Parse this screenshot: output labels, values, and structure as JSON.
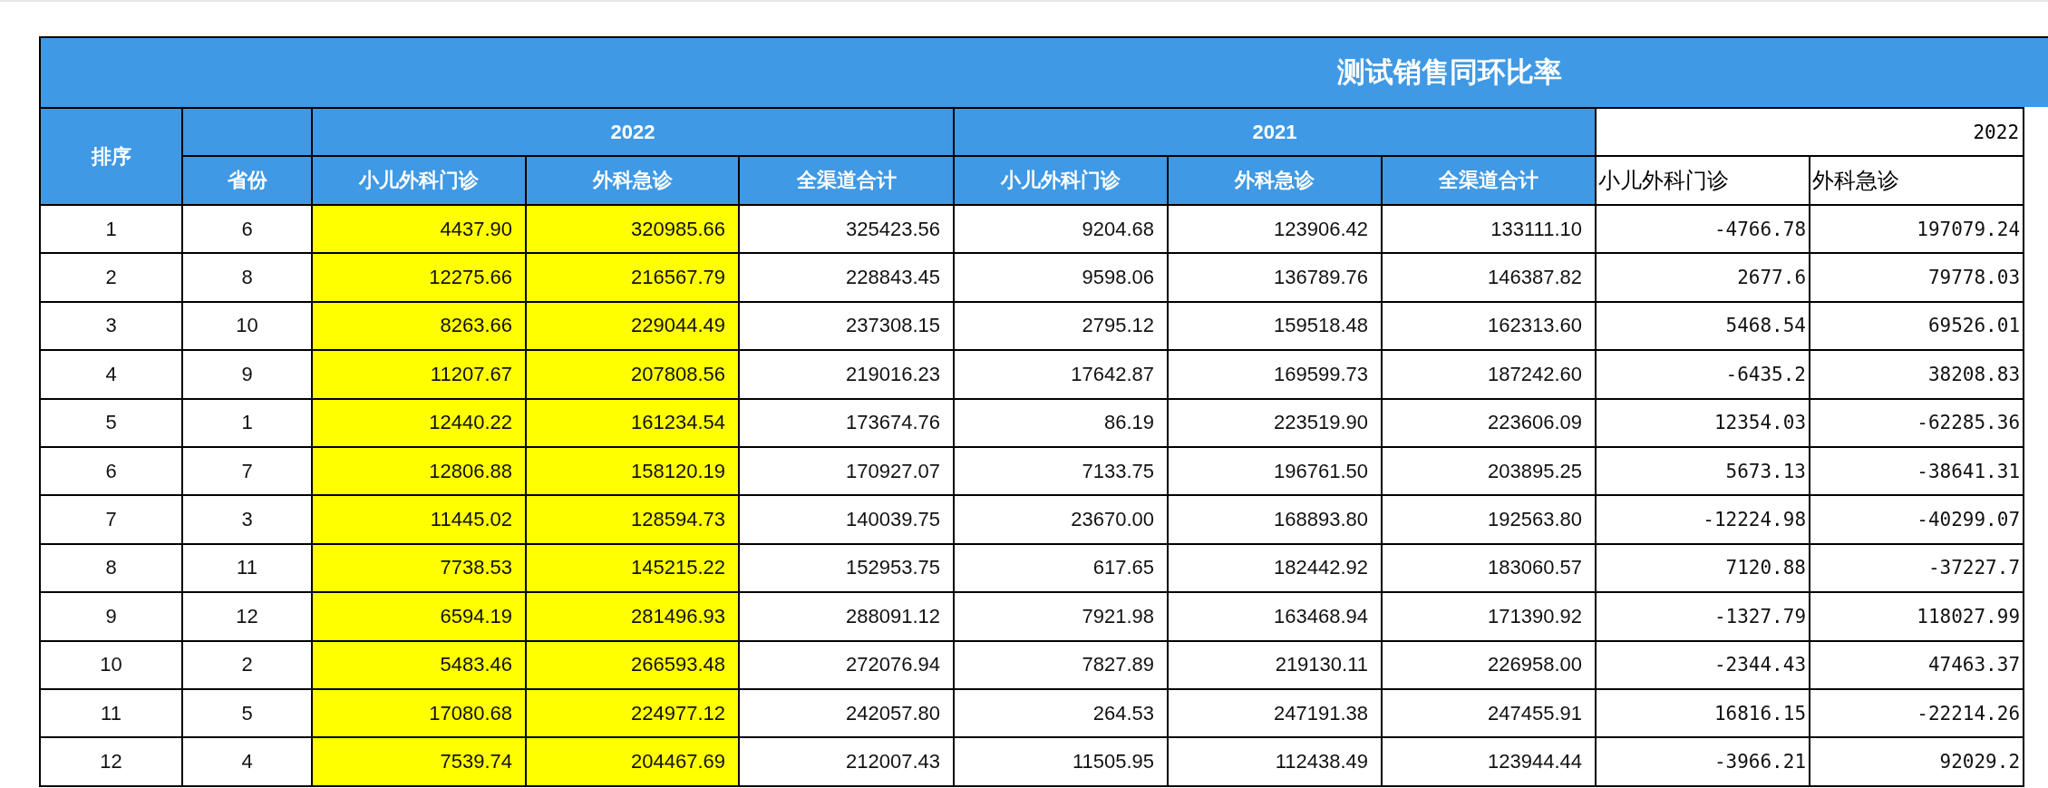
{
  "title": "测试销售同环比率",
  "rank_header": "排序",
  "groups": [
    {
      "kind": "source",
      "columns": [
        {
          "label": "省份",
          "highlighted": false
        }
      ]
    },
    {
      "label": "2022",
      "kind": "source",
      "columns": [
        {
          "label": "小儿外科门诊",
          "highlighted": true
        },
        {
          "label": "外科急诊",
          "highlighted": true
        },
        {
          "label": "全渠道合计",
          "highlighted": false
        }
      ]
    },
    {
      "label": "2021",
      "kind": "source",
      "columns": [
        {
          "label": "小儿外科门诊",
          "highlighted": false
        },
        {
          "label": "外科急诊",
          "highlighted": false
        },
        {
          "label": "全渠道合计",
          "highlighted": false
        }
      ]
    },
    {
      "label": "2022",
      "kind": "difference",
      "columns": [
        {
          "label": "小儿外科门诊",
          "highlighted": false
        },
        {
          "label": "外科急诊",
          "highlighted": false
        }
      ]
    }
  ],
  "rows": [
    {
      "cells": [
        "1",
        "6",
        "4437.90",
        "320985.66",
        "325423.56",
        "9204.68",
        "123906.42",
        "133111.10",
        "-4766.78",
        "197079.24"
      ]
    },
    {
      "cells": [
        "2",
        "8",
        "12275.66",
        "216567.79",
        "228843.45",
        "9598.06",
        "136789.76",
        "146387.82",
        "2677.6",
        "79778.03"
      ]
    },
    {
      "cells": [
        "3",
        "10",
        "8263.66",
        "229044.49",
        "237308.15",
        "2795.12",
        "159518.48",
        "162313.60",
        "5468.54",
        "69526.01"
      ]
    },
    {
      "cells": [
        "4",
        "9",
        "11207.67",
        "207808.56",
        "219016.23",
        "17642.87",
        "169599.73",
        "187242.60",
        "-6435.2",
        "38208.83"
      ]
    },
    {
      "cells": [
        "5",
        "1",
        "12440.22",
        "161234.54",
        "173674.76",
        "86.19",
        "223519.90",
        "223606.09",
        "12354.03",
        "-62285.36"
      ]
    },
    {
      "cells": [
        "6",
        "7",
        "12806.88",
        "158120.19",
        "170927.07",
        "7133.75",
        "196761.50",
        "203895.25",
        "5673.13",
        "-38641.31"
      ]
    },
    {
      "cells": [
        "7",
        "3",
        "11445.02",
        "128594.73",
        "140039.75",
        "23670.00",
        "168893.80",
        "192563.80",
        "-12224.98",
        "-40299.07"
      ]
    },
    {
      "cells": [
        "8",
        "11",
        "7738.53",
        "145215.22",
        "152953.75",
        "617.65",
        "182442.92",
        "183060.57",
        "7120.88",
        "-37227.7"
      ]
    },
    {
      "cells": [
        "9",
        "12",
        "6594.19",
        "281496.93",
        "288091.12",
        "7921.98",
        "163468.94",
        "171390.92",
        "-1327.79",
        "118027.99"
      ]
    },
    {
      "cells": [
        "10",
        "2",
        "5483.46",
        "266593.48",
        "272076.94",
        "7827.89",
        "219130.11",
        "226958.00",
        "-2344.43",
        "47463.37"
      ]
    },
    {
      "cells": [
        "11",
        "5",
        "17080.68",
        "224977.12",
        "242057.80",
        "264.53",
        "247191.38",
        "247455.91",
        "16816.15",
        "-22214.26"
      ]
    },
    {
      "cells": [
        "12",
        "4",
        "7539.74",
        "204467.69",
        "212007.43",
        "11505.95",
        "112438.49",
        "123944.44",
        "-3966.21",
        "92029.2"
      ]
    }
  ]
}
